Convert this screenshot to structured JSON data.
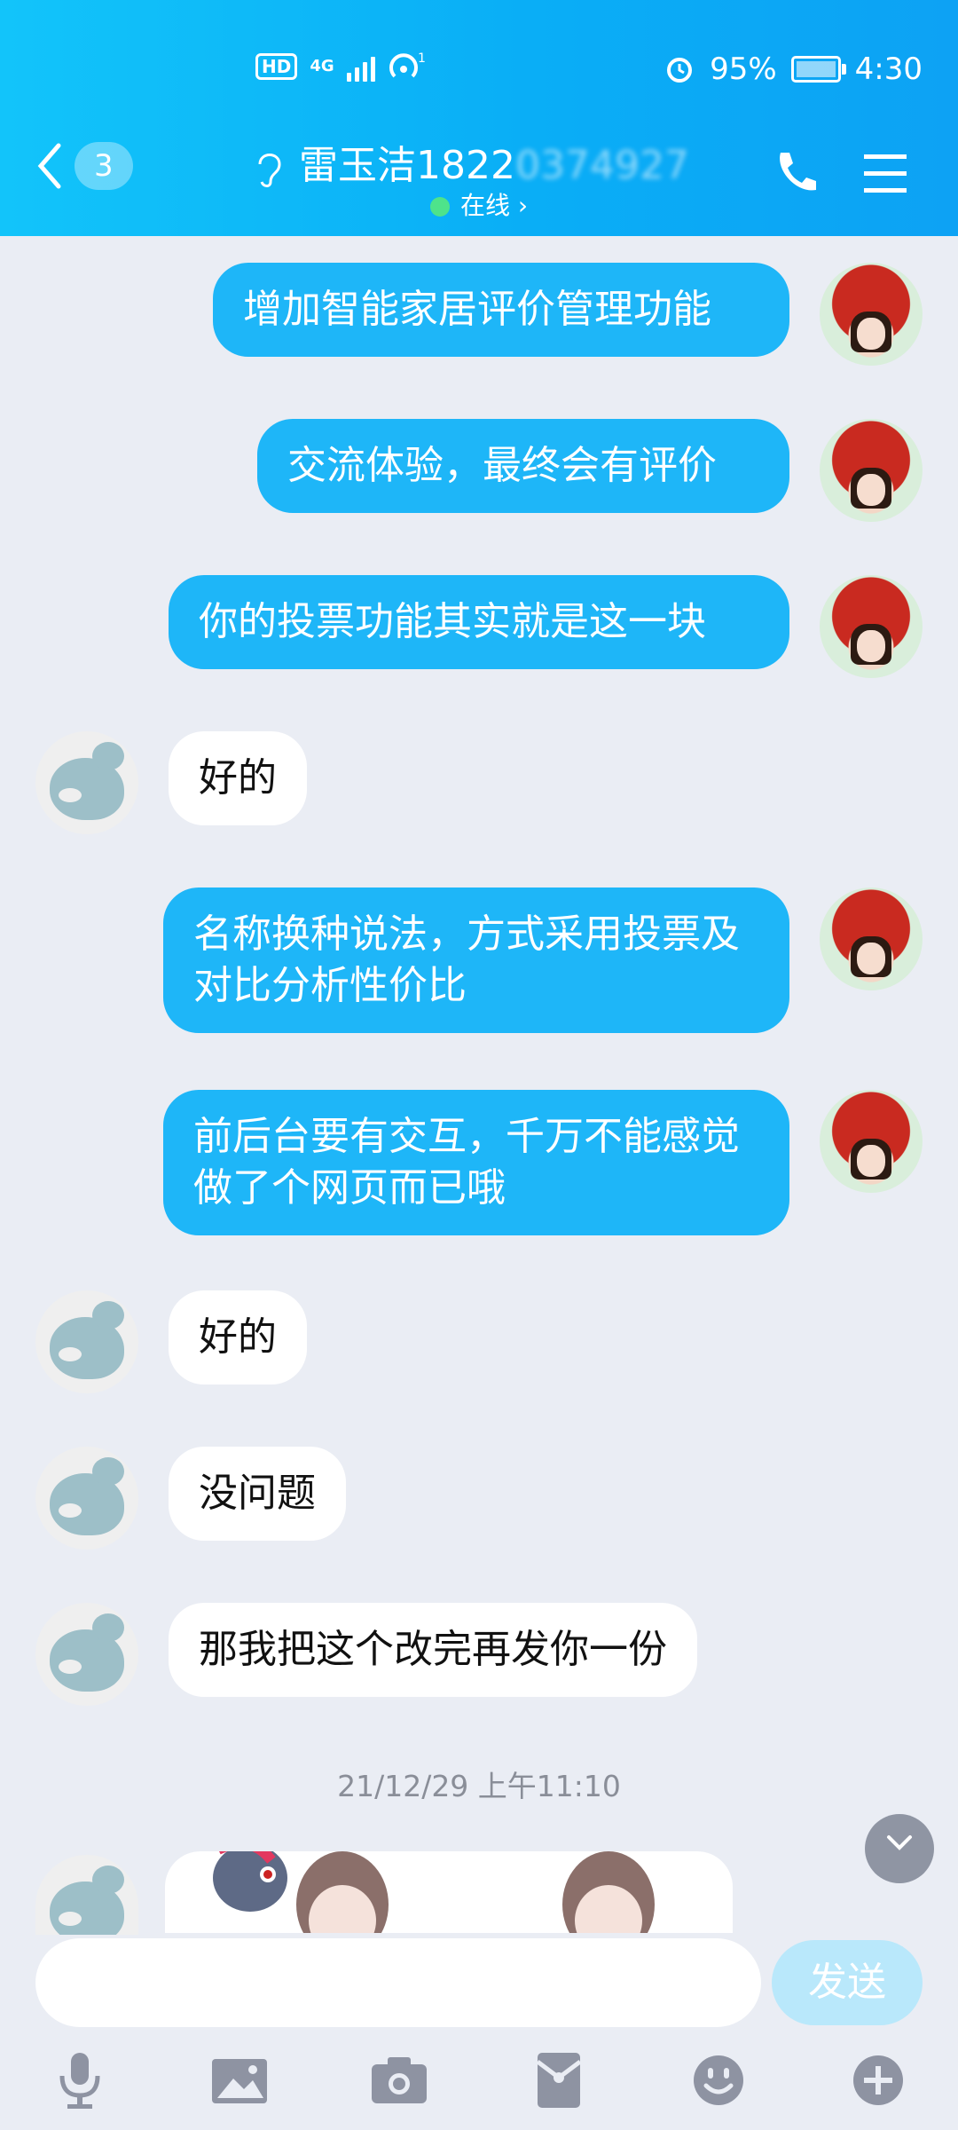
{
  "status_bar": {
    "hd": "HD",
    "network": "4G",
    "battery": "95%",
    "time": "4:30"
  },
  "header": {
    "back_count": "3",
    "contact_name": "雷玉洁1822",
    "contact_name_obscured": "0374927",
    "online_status": "在线",
    "chevron": "›"
  },
  "messages": [
    {
      "side": "out",
      "text": "增加智能家居评价管理功能"
    },
    {
      "side": "out",
      "text": "交流体验，最终会有评价"
    },
    {
      "side": "out",
      "text": "你的投票功能其实就是这一块"
    },
    {
      "side": "in",
      "text": "好的"
    },
    {
      "side": "out",
      "text": "名称换种说法，方式采用投票及对比分析性价比"
    },
    {
      "side": "out",
      "text": "前后台要有交互，千万不能感觉做了个网页而已哦"
    },
    {
      "side": "in",
      "text": "好的"
    },
    {
      "side": "in",
      "text": "没问题"
    },
    {
      "side": "in",
      "text": "那我把这个改完再发你一份"
    }
  ],
  "timestamp": "21/12/29 上午11:10",
  "input": {
    "placeholder": "",
    "send_label": "发送"
  },
  "toolbar": [
    "microphone-icon",
    "image-icon",
    "camera-icon",
    "red-packet-icon",
    "emoji-icon",
    "plus-icon"
  ]
}
